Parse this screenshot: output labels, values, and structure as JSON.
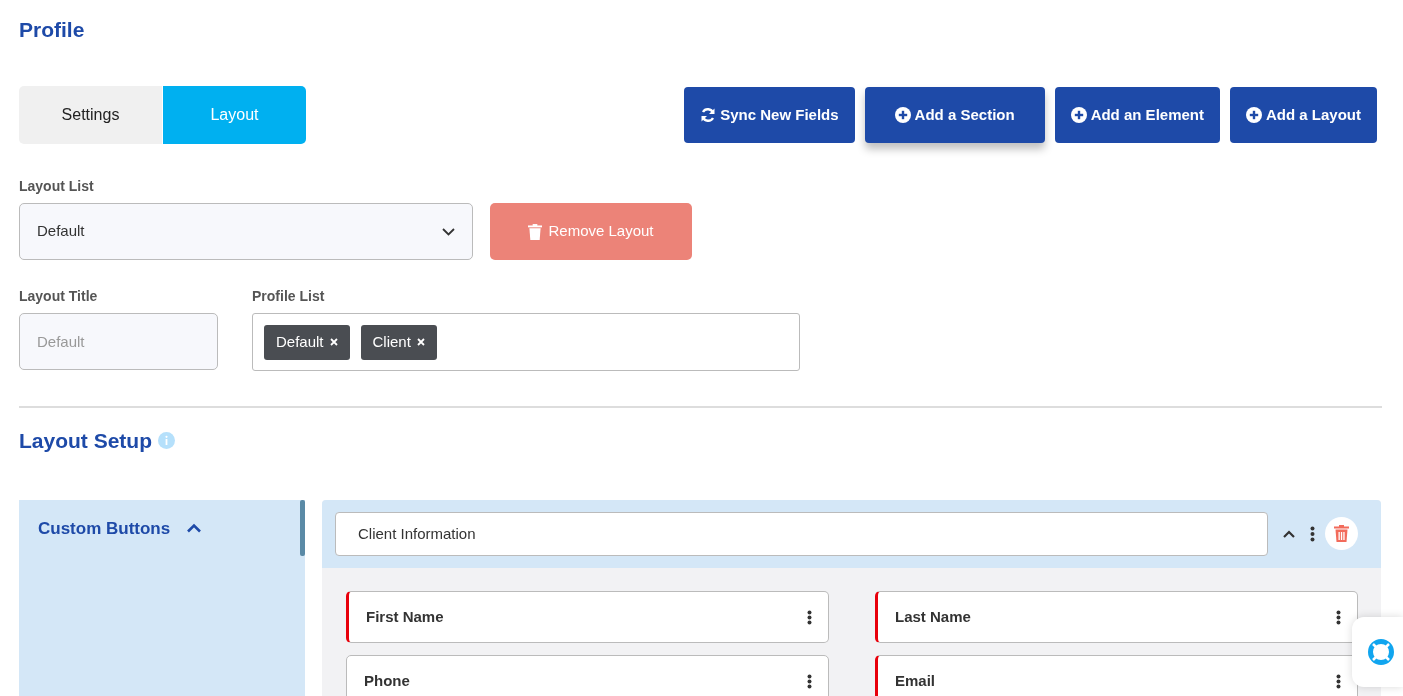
{
  "page_title": "Profile",
  "tabs": [
    {
      "label": "Settings",
      "selected": false
    },
    {
      "label": "Layout",
      "selected": true
    }
  ],
  "actions": [
    {
      "label": "Sync New Fields",
      "kind": "sync"
    },
    {
      "label": "Add a Section",
      "kind": "add"
    },
    {
      "label": "Add an Element",
      "kind": "add"
    },
    {
      "label": "Add a Layout",
      "kind": "add"
    }
  ],
  "layout_list": {
    "label": "Layout List",
    "value": "Default"
  },
  "remove_button": {
    "label": "Remove Layout",
    "disabled": true
  },
  "layout_title": {
    "label": "Layout Title",
    "placeholder": "Default"
  },
  "profile_list": {
    "label": "Profile List",
    "tags": [
      "Default",
      "Client"
    ]
  },
  "layout_setup": {
    "title": "Layout Setup",
    "sidebar": {
      "title": "Custom Buttons",
      "expanded": true
    },
    "section": {
      "title": "Client Information",
      "expanded": true,
      "fields": [
        {
          "label": "First Name",
          "required": true
        },
        {
          "label": "Last Name",
          "required": true
        },
        {
          "label": "Phone",
          "required": false
        },
        {
          "label": "Email",
          "required": true
        }
      ]
    }
  }
}
